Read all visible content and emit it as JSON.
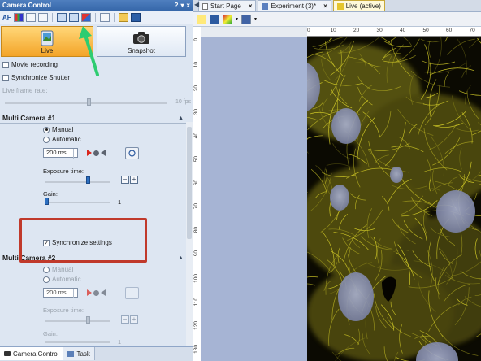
{
  "panel": {
    "title": "Camera Control",
    "title_buttons": [
      "?",
      "▾",
      "x"
    ],
    "toolbar_af": "AF"
  },
  "modes": {
    "live_label": "Live",
    "snapshot_label": "Snapshot"
  },
  "options": {
    "movie_recording": "Movie recording",
    "sync_shutter": "Synchronize Shutter",
    "live_frame_rate": "Live frame rate:",
    "fps_value": "10 fps"
  },
  "camera1": {
    "header": "Multi Camera #1",
    "manual": "Manual",
    "automatic": "Automatic",
    "exposure_value": "200 ms",
    "exposure_time_label": "Exposure time:",
    "gain_label": "Gain:",
    "gain_value": "1",
    "sync_settings": "Synchronize settings"
  },
  "camera2": {
    "header": "Multi Camera #2",
    "manual": "Manual",
    "automatic": "Automatic",
    "exposure_value": "200 ms",
    "exposure_time_label": "Exposure time:",
    "gain_label": "Gain:",
    "gain_value": "1"
  },
  "bottom_tabs": [
    "Camera Control",
    "Task"
  ],
  "doc_tabs": [
    {
      "label": "Start Page",
      "active": false
    },
    {
      "label": "Experiment (3)*",
      "active": false
    },
    {
      "label": "Live (active)",
      "active": true
    }
  ],
  "ruler_top": [
    "0",
    "10",
    "20",
    "30",
    "40",
    "50",
    "60",
    "70"
  ],
  "ruler_left": [
    "0",
    "10",
    "20",
    "30",
    "40",
    "50",
    "60",
    "70",
    "80",
    "90",
    "100",
    "110",
    "120",
    "130"
  ],
  "colors": {
    "annotation_box": "#c0392b",
    "annotation_arrow": "#2ecc71",
    "live_button": "#f3a428",
    "fluorescence": "#e8e02c",
    "nucleus": "#8f97b8"
  }
}
